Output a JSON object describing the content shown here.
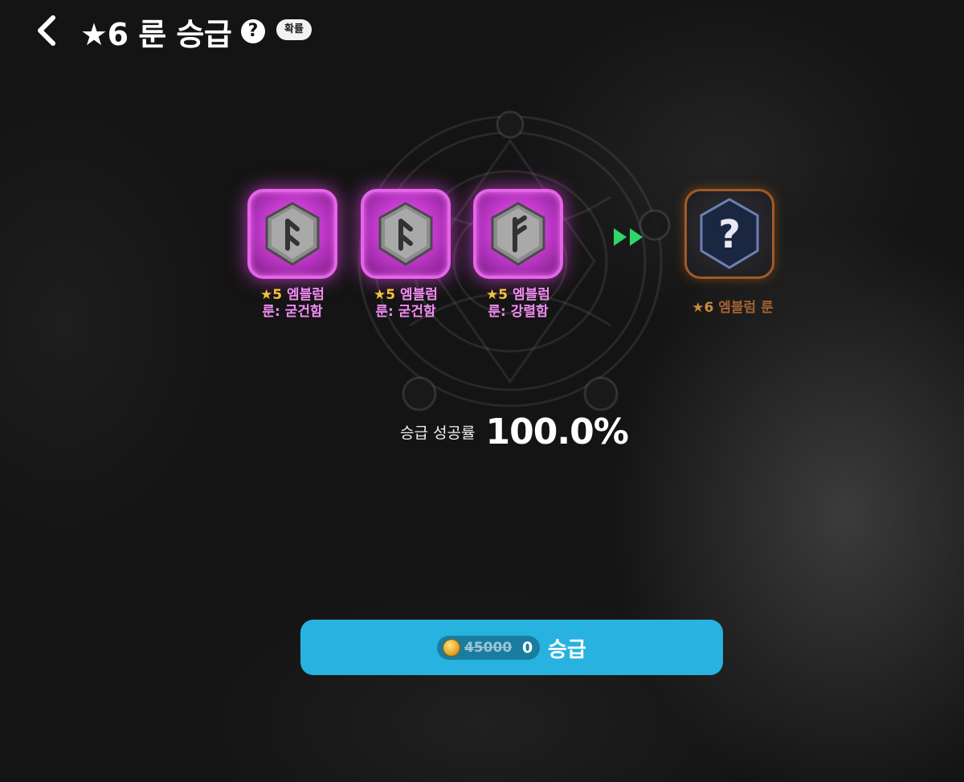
{
  "header": {
    "title": "★6 룬 승급",
    "help": "?",
    "probability_label": "확률"
  },
  "materials": [
    {
      "star": "★5",
      "line1": "엠블럼",
      "line2": "룬: 굳건함"
    },
    {
      "star": "★5",
      "line1": "엠블럼",
      "line2": "룬: 굳건함"
    },
    {
      "star": "★5",
      "line1": "엠블럼",
      "line2": "룬: 강렬함"
    }
  ],
  "result": {
    "star": "★6",
    "name": "엠블럼 룬",
    "icon": "?"
  },
  "success": {
    "label": "승급 성공률",
    "value": "100.0%"
  },
  "upgrade_button": {
    "old_cost": "45000",
    "new_cost": "0",
    "label": "승급"
  },
  "colors": {
    "accent": "#28b2df",
    "material_border": "#e565e8",
    "result_border": "#a15a26",
    "arrow": "#2fd66a"
  }
}
